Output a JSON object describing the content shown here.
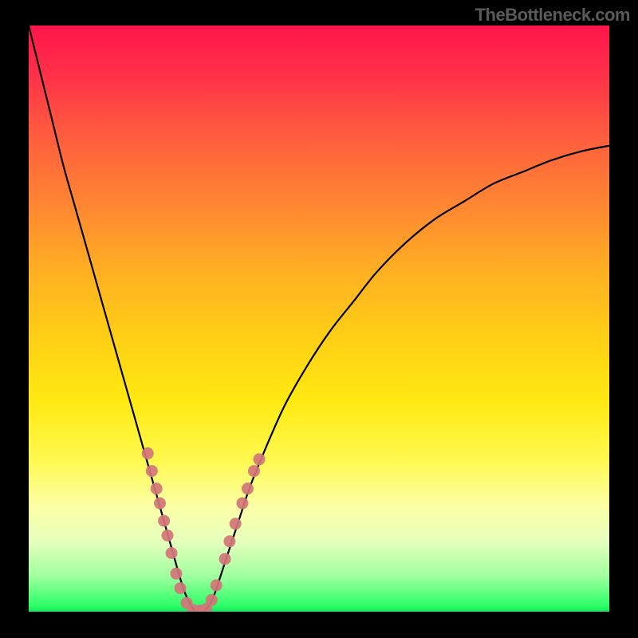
{
  "watermark": "TheBottleneck.com",
  "colors": {
    "curve_stroke": "#000000",
    "marker_fill": "#d37579",
    "marker_stroke": "#9a4b50",
    "background_top": "#ff154a",
    "background_bottom": "#15e85a",
    "frame": "#000000"
  },
  "chart_data": {
    "type": "line",
    "title": "",
    "xlabel": "",
    "ylabel": "",
    "xlim": [
      0,
      100
    ],
    "ylim": [
      0,
      100
    ],
    "series": [
      {
        "name": "bottleneck-curve",
        "x": [
          0,
          2,
          4,
          6,
          8,
          10,
          12,
          14,
          16,
          18,
          20,
          22,
          24,
          26,
          27,
          28,
          29,
          30,
          31,
          32,
          34,
          36,
          38,
          40,
          44,
          48,
          52,
          56,
          60,
          65,
          70,
          75,
          80,
          85,
          90,
          95,
          100
        ],
        "y": [
          100,
          92,
          84,
          76,
          69,
          62,
          55,
          48,
          41,
          34,
          27,
          20,
          13,
          6,
          3,
          1,
          0,
          0,
          1,
          3,
          9,
          15,
          21,
          26,
          35,
          42,
          48,
          53,
          58,
          63,
          67,
          70,
          73,
          75,
          77,
          78.5,
          79.5
        ]
      }
    ],
    "markers": [
      {
        "x": 20.5,
        "y": 27
      },
      {
        "x": 21.2,
        "y": 24
      },
      {
        "x": 22.0,
        "y": 21
      },
      {
        "x": 22.6,
        "y": 18.5
      },
      {
        "x": 23.3,
        "y": 15.5
      },
      {
        "x": 23.9,
        "y": 13
      },
      {
        "x": 24.6,
        "y": 10
      },
      {
        "x": 25.4,
        "y": 6.5
      },
      {
        "x": 26.1,
        "y": 4
      },
      {
        "x": 27.2,
        "y": 1.5
      },
      {
        "x": 28.3,
        "y": 0.3
      },
      {
        "x": 29.5,
        "y": 0.2
      },
      {
        "x": 30.6,
        "y": 0.5
      },
      {
        "x": 31.5,
        "y": 2
      },
      {
        "x": 32.3,
        "y": 4.5
      },
      {
        "x": 33.8,
        "y": 9
      },
      {
        "x": 34.6,
        "y": 12
      },
      {
        "x": 35.6,
        "y": 15
      },
      {
        "x": 36.8,
        "y": 18.5
      },
      {
        "x": 37.7,
        "y": 21
      },
      {
        "x": 38.8,
        "y": 24
      },
      {
        "x": 39.7,
        "y": 26
      }
    ]
  }
}
